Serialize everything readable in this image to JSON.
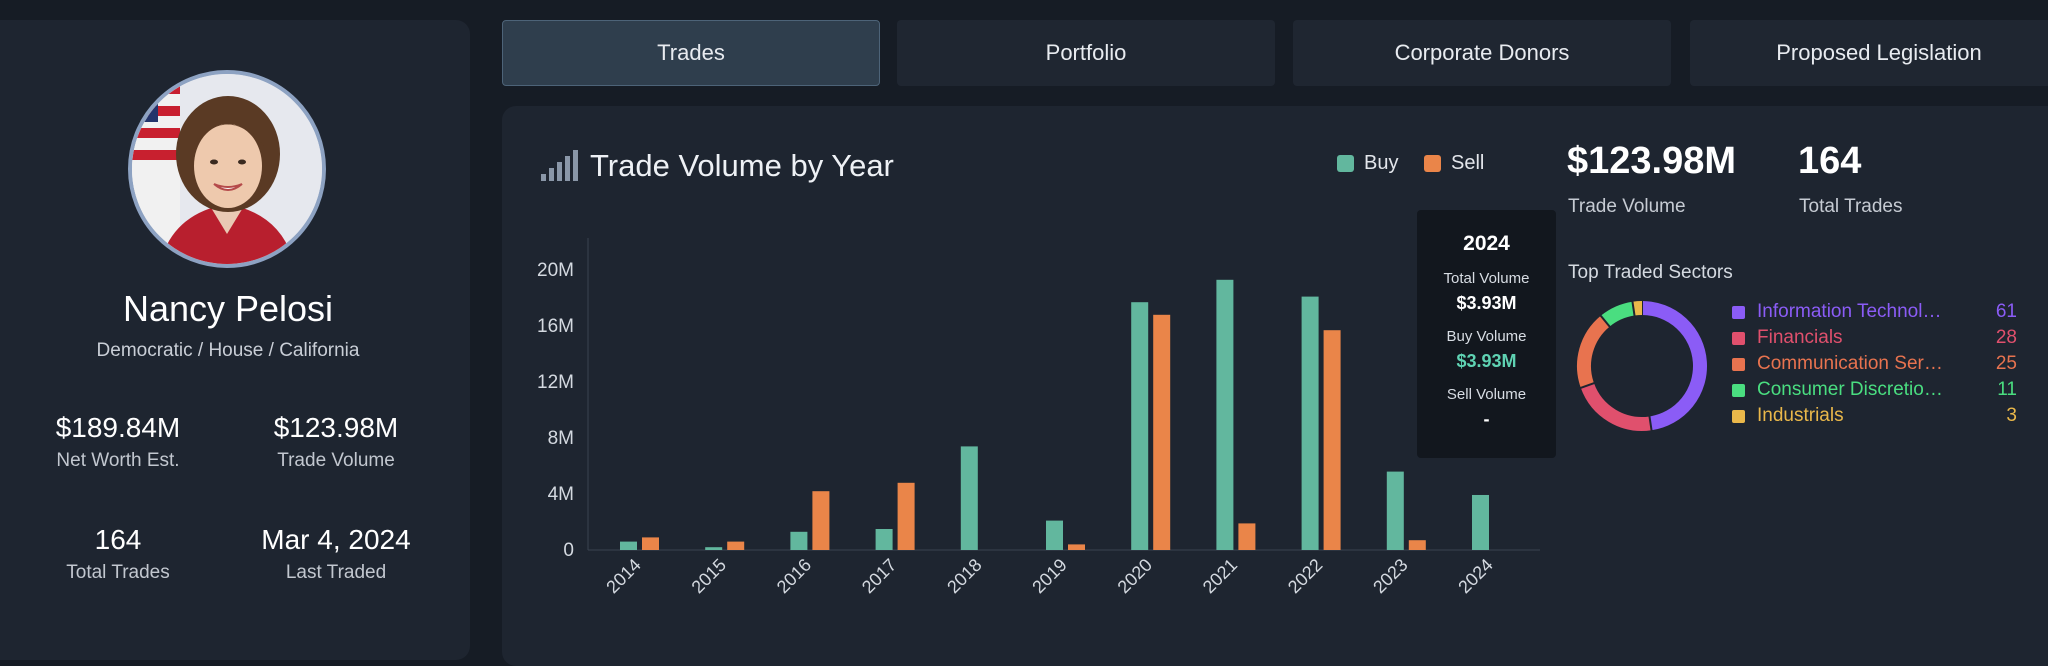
{
  "profile": {
    "name": "Nancy Pelosi",
    "subtitle": "Democratic / House / California",
    "stats": [
      {
        "value": "$189.84M",
        "label": "Net Worth Est."
      },
      {
        "value": "$123.98M",
        "label": "Trade Volume"
      },
      {
        "value": "164",
        "label": "Total Trades"
      },
      {
        "value": "Mar 4, 2024",
        "label": "Last Traded"
      }
    ]
  },
  "tabs": [
    "Trades",
    "Portfolio",
    "Corporate Donors",
    "Proposed Legislation"
  ],
  "active_tab": "Trades",
  "chart_title": "Trade Volume by Year",
  "legend": {
    "buy": "Buy",
    "sell": "Sell"
  },
  "tooltip": {
    "year": "2024",
    "total_label": "Total Volume",
    "total_value": "$3.93M",
    "buy_label": "Buy Volume",
    "buy_value": "$3.93M",
    "sell_label": "Sell Volume",
    "sell_value": "-"
  },
  "summary": {
    "trade_volume": "$123.98M",
    "trade_volume_label": "Trade Volume",
    "total_trades": "164",
    "total_trades_label": "Total Trades"
  },
  "sectors_title": "Top Traded Sectors",
  "sectors": [
    {
      "name": "Information Technol…",
      "count": "61",
      "color": "#8b5cf6"
    },
    {
      "name": "Financials",
      "count": "28",
      "color": "#e0506d"
    },
    {
      "name": "Communication Ser…",
      "count": "25",
      "color": "#e8734f"
    },
    {
      "name": "Consumer Discretio…",
      "count": "11",
      "color": "#4ade80"
    },
    {
      "name": "Industrials",
      "count": "3",
      "color": "#eab84a"
    }
  ],
  "colors": {
    "buy": "#62b79e",
    "sell": "#ea8549",
    "accent": "#8da2c2"
  },
  "chart_data": [
    {
      "type": "bar",
      "title": "Trade Volume by Year",
      "categories": [
        "2014",
        "2015",
        "2016",
        "2017",
        "2018",
        "2019",
        "2020",
        "2021",
        "2022",
        "2023",
        "2024"
      ],
      "series": [
        {
          "name": "Buy",
          "values": [
            0.6,
            0.2,
            1.3,
            1.5,
            7.4,
            2.1,
            17.7,
            19.3,
            18.1,
            5.6,
            3.93
          ]
        },
        {
          "name": "Sell",
          "values": [
            0.9,
            0.6,
            4.2,
            4.8,
            0,
            0.4,
            16.8,
            1.9,
            15.7,
            0.7,
            0
          ]
        }
      ],
      "yticks": [
        "0",
        "4M",
        "8M",
        "12M",
        "16M",
        "20M"
      ],
      "ylim": [
        0,
        21
      ],
      "unit": "M USD",
      "legend": "top-right",
      "grid": false
    },
    {
      "type": "pie",
      "title": "Top Traded Sectors",
      "categories": [
        "Information Technology",
        "Financials",
        "Communication Services",
        "Consumer Discretionary",
        "Industrials"
      ],
      "values": [
        61,
        28,
        25,
        11,
        3
      ],
      "donut": true
    }
  ]
}
